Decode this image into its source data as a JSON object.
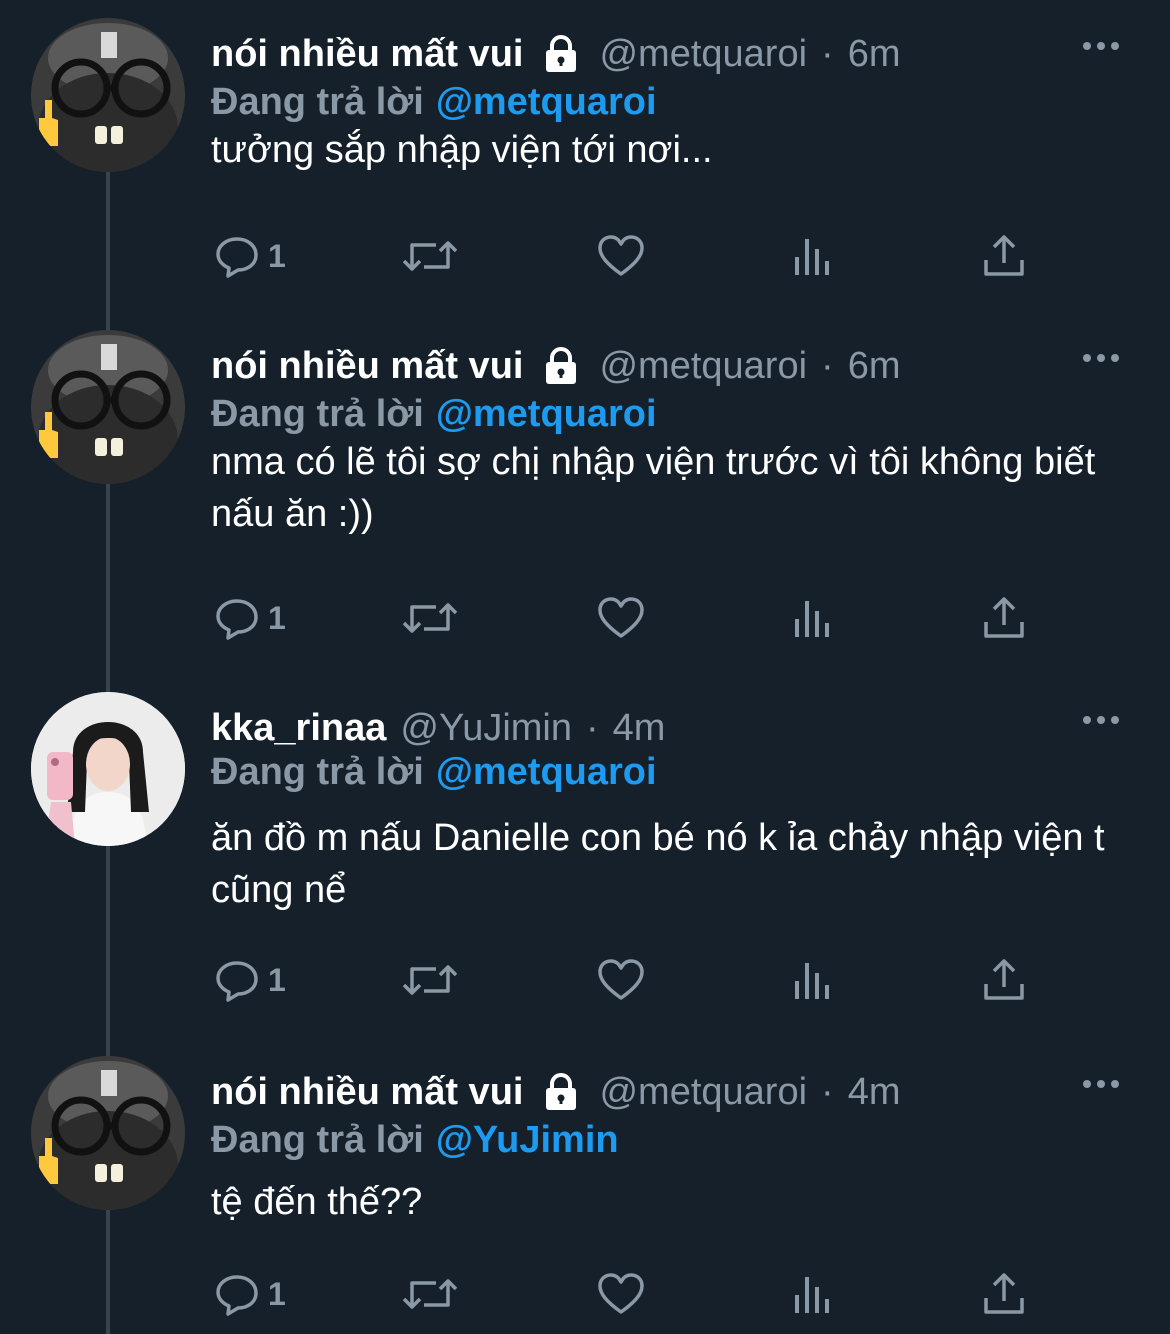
{
  "tweets": [
    {
      "name": "nói nhiều mất vui",
      "locked": true,
      "handle": "@metquaroi",
      "time": "6m",
      "reply_prefix": "Đang trả lời",
      "reply_to": "@metquaroi",
      "text": "tưởng sắp nhập viện tới nơi...",
      "reply_count": "1",
      "avatar": "cat-avatar"
    },
    {
      "name": "nói nhiều mất vui",
      "locked": true,
      "handle": "@metquaroi",
      "time": "6m",
      "reply_prefix": "Đang trả lời",
      "reply_to": "@metquaroi",
      "text": "nma có lẽ tôi sợ chị nhập viện trước vì tôi không biết nấu ăn :))",
      "reply_count": "1",
      "avatar": "cat-avatar"
    },
    {
      "name": "kka_rinaa",
      "locked": false,
      "handle": "@YuJimin",
      "time": "4m",
      "reply_prefix": "Đang trả lời",
      "reply_to": "@metquaroi",
      "text": "ăn đồ m nấu Danielle con bé nó k ỉa chảy nhập viện t cũng nể",
      "reply_count": "1",
      "avatar": "girl-avatar"
    },
    {
      "name": "nói nhiều mất vui",
      "locked": true,
      "handle": "@metquaroi",
      "time": "4m",
      "reply_prefix": "Đang trả lời",
      "reply_to": "@YuJimin",
      "text": "tệ đến thế??",
      "reply_count": "1",
      "avatar": "cat-avatar"
    }
  ],
  "separator": "·",
  "colors": {
    "background": "#15202b",
    "muted": "#8b98a5",
    "accent": "#1d9bf0",
    "thread_line": "#38444d"
  },
  "icons": {
    "reply": "reply-icon",
    "retweet": "retweet-icon",
    "like": "heart-icon",
    "views": "views-icon",
    "share": "share-icon",
    "lock": "lock-icon",
    "more": "more-icon"
  }
}
